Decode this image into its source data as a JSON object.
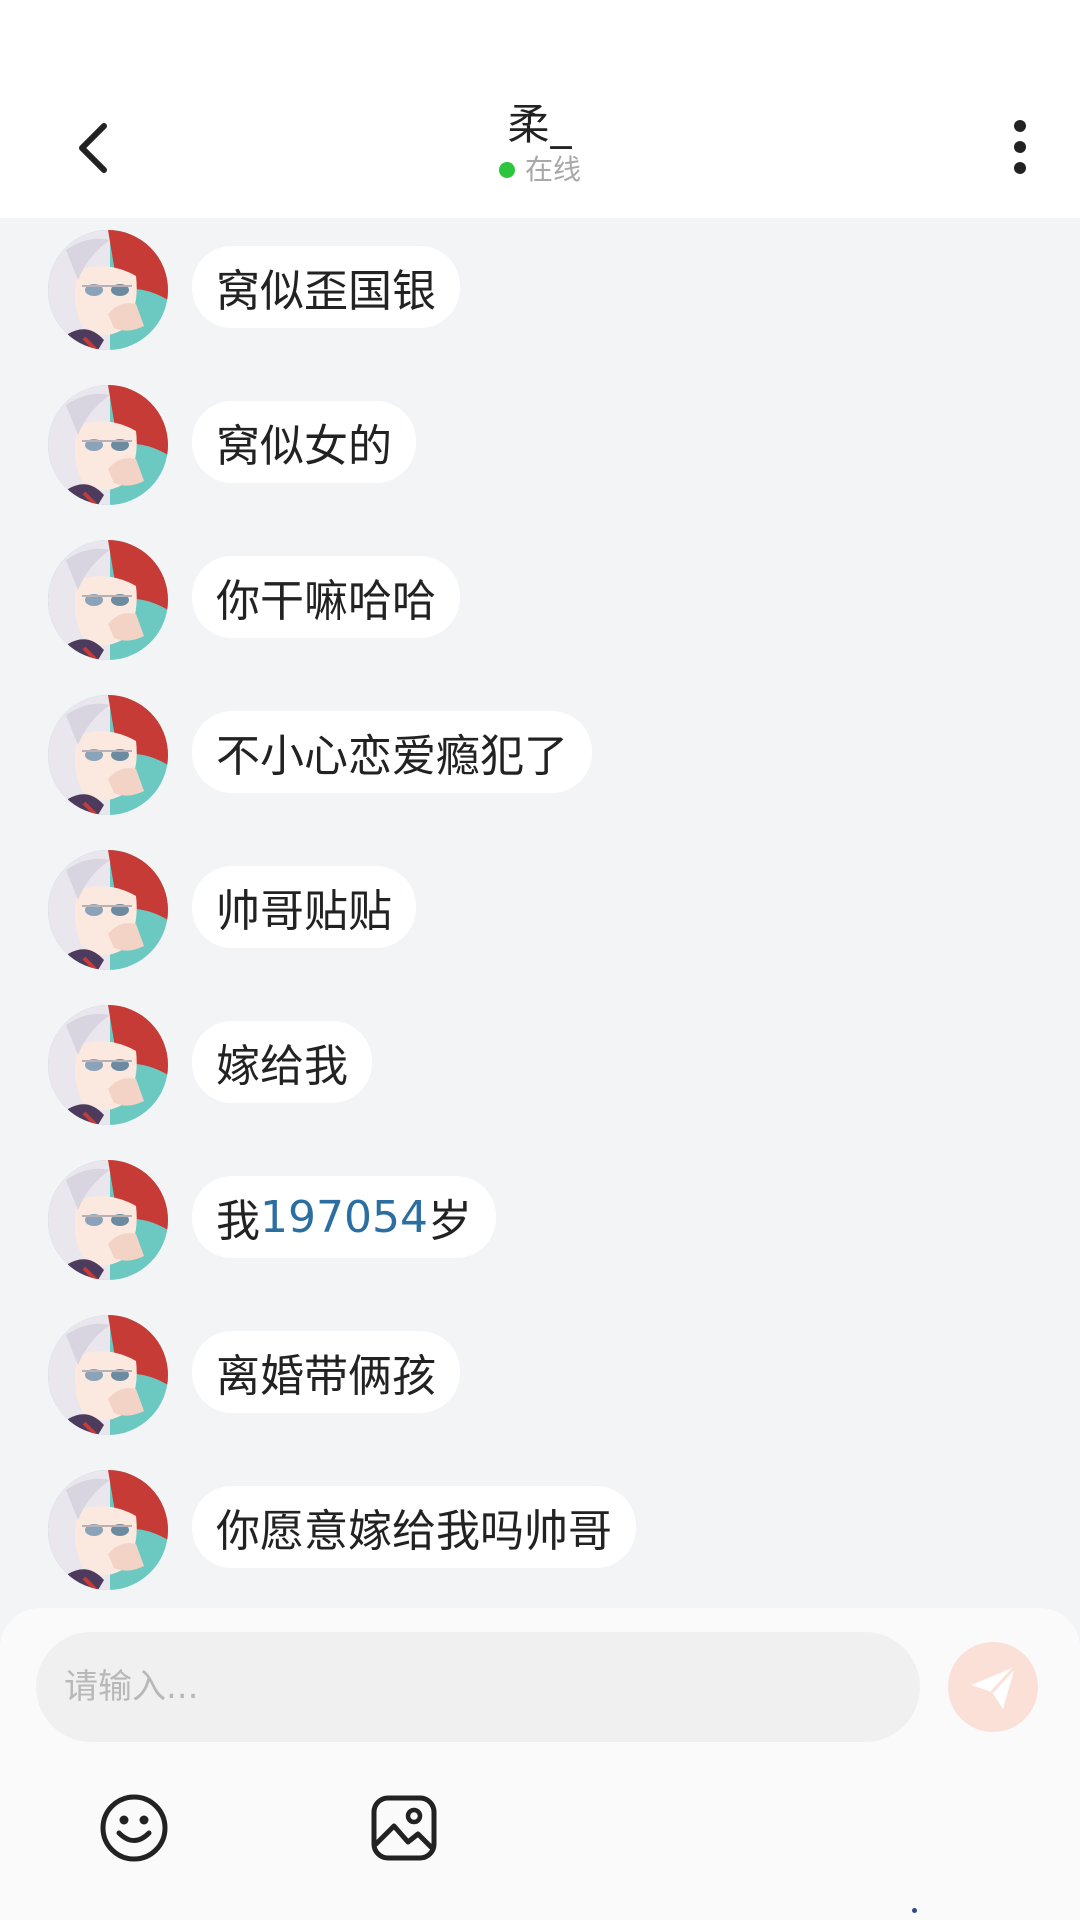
{
  "header": {
    "title": "柔_",
    "status": "在线",
    "status_color": "#2dc53c",
    "back_icon": "chevron-left-icon",
    "more_icon": "more-vertical-icon"
  },
  "messages": [
    {
      "text": "窝似歪国银",
      "highlight": "",
      "after": ""
    },
    {
      "text": "窝似女的",
      "highlight": "",
      "after": ""
    },
    {
      "text": "你干嘛哈哈",
      "highlight": "",
      "after": ""
    },
    {
      "text": "不小心恋爱瘾犯了",
      "highlight": "",
      "after": ""
    },
    {
      "text": "帅哥贴贴",
      "highlight": "",
      "after": ""
    },
    {
      "text": "嫁给我",
      "highlight": "",
      "after": ""
    },
    {
      "text": "我",
      "highlight": "197054",
      "after": "岁"
    },
    {
      "text": "离婚带俩孩",
      "highlight": "",
      "after": ""
    },
    {
      "text": "你愿意嫁给我吗帅哥",
      "highlight": "",
      "after": ""
    }
  ],
  "input": {
    "placeholder": "请输入...",
    "value": ""
  },
  "toolbar": {
    "send_icon": "paper-plane-icon",
    "emoji_icon": "smiley-icon",
    "image_icon": "image-icon"
  },
  "colors": {
    "background": "#f2f4f5",
    "bubble": "#ffffff",
    "number_link": "#2b6ea1",
    "send_button": "#fbe0d8"
  }
}
